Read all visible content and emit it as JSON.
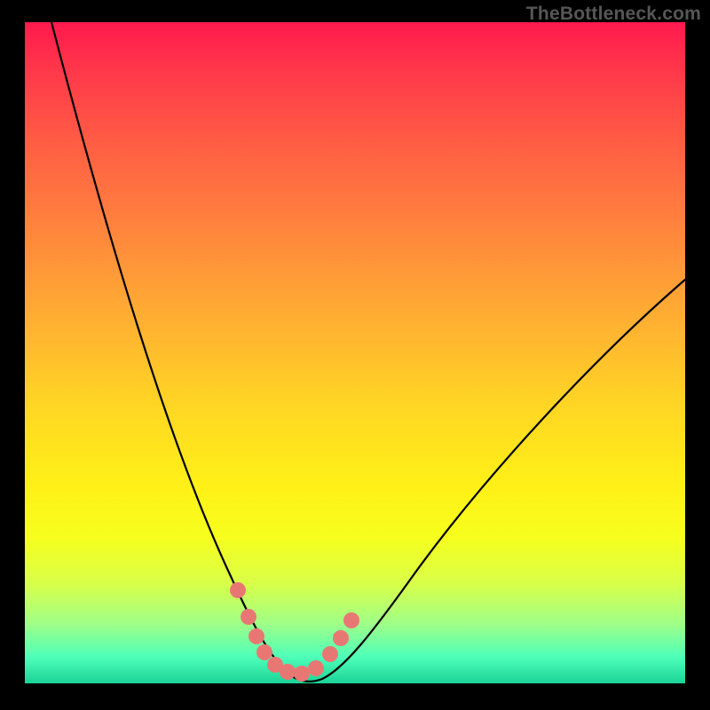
{
  "watermark": "TheBottleneck.com",
  "chart_data": {
    "type": "line",
    "title": "",
    "xlabel": "",
    "ylabel": "",
    "xlim": [
      0,
      100
    ],
    "ylim": [
      0,
      100
    ],
    "series": [
      {
        "name": "bottleneck-curve",
        "x": [
          4,
          8,
          12,
          16,
          20,
          24,
          28,
          30,
          32,
          34,
          36,
          38,
          40,
          42,
          46,
          50,
          56,
          62,
          70,
          78,
          86,
          94,
          100
        ],
        "y": [
          100,
          88,
          76,
          64,
          52,
          40,
          28,
          22,
          16,
          10,
          5,
          2,
          0,
          0,
          2,
          6,
          12,
          20,
          30,
          40,
          50,
          58,
          64
        ]
      }
    ],
    "markers": {
      "name": "highlighted-points",
      "x": [
        31,
        33,
        34.5,
        36,
        38,
        40,
        42,
        44,
        45,
        47,
        49
      ],
      "y": [
        16,
        10,
        6,
        3,
        1,
        0,
        0,
        1,
        4,
        8,
        12
      ]
    },
    "colors": {
      "curve": "#000000",
      "marker": "#e87774",
      "gradient_top": "#ff1a4d",
      "gradient_bottom": "#1bd397"
    }
  }
}
